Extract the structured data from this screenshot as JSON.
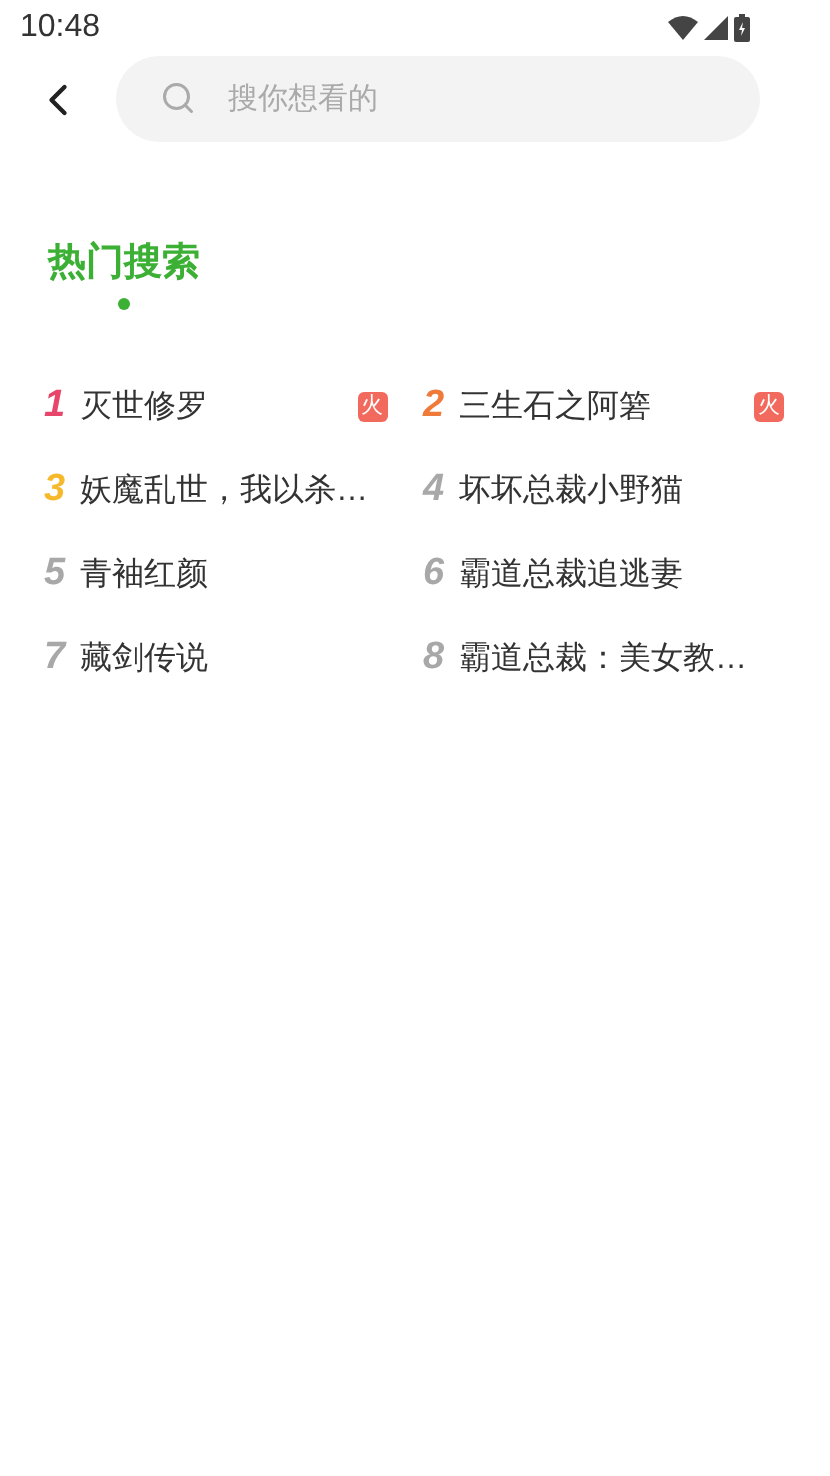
{
  "status_bar": {
    "time": "10:48"
  },
  "search": {
    "placeholder": "搜你想看的"
  },
  "section": {
    "title": "热门搜索",
    "selected": true
  },
  "hot_searches": [
    {
      "rank": "1",
      "title": "灭世修罗",
      "color": "#e8456b",
      "badge": "火"
    },
    {
      "rank": "2",
      "title": "三生石之阿箬",
      "color": "#f07a3a",
      "badge": "火"
    },
    {
      "rank": "3",
      "title": "妖魔乱世，我以杀…",
      "color": "#f6b92b"
    },
    {
      "rank": "4",
      "title": "坏坏总裁小野猫",
      "color": "#a8a8a8"
    },
    {
      "rank": "5",
      "title": "青袖红颜",
      "color": "#a8a8a8"
    },
    {
      "rank": "6",
      "title": "霸道总裁追逃妻",
      "color": "#a8a8a8"
    },
    {
      "rank": "7",
      "title": "藏剑传说",
      "color": "#a8a8a8"
    },
    {
      "rank": "8",
      "title": "霸道总裁：美女教…",
      "color": "#a8a8a8"
    }
  ]
}
